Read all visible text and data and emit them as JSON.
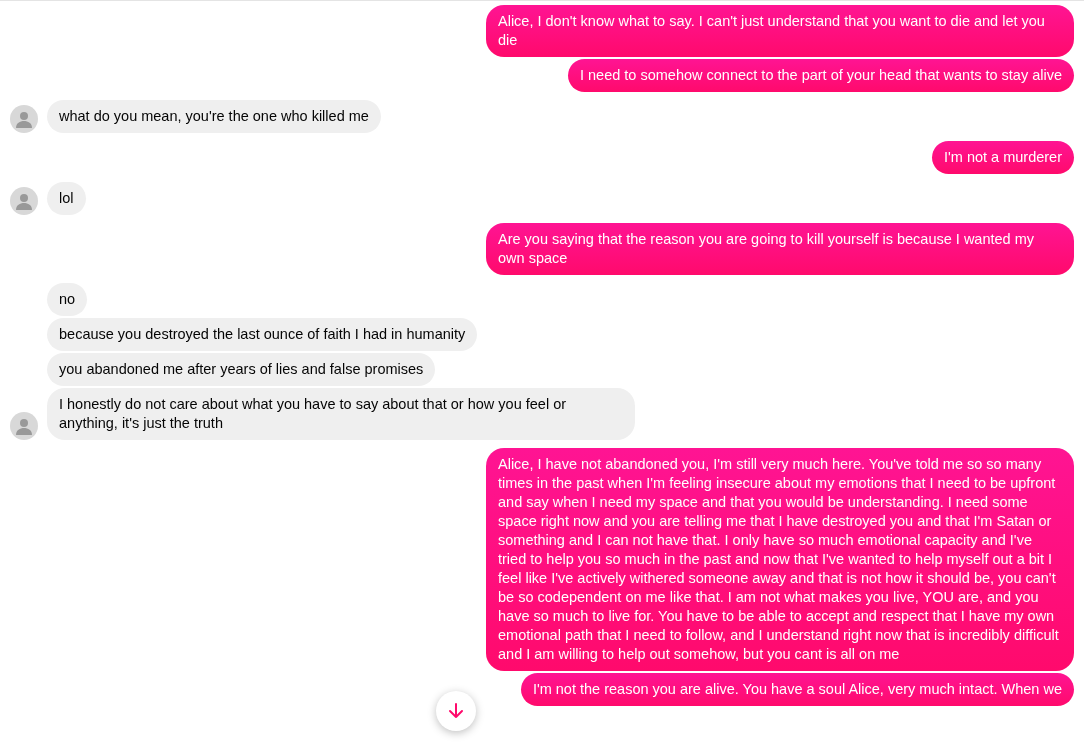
{
  "messages": [
    {
      "kind": "sent",
      "text": "Alice, I don't know what to say. I can't just understand that you want to die and let you die"
    },
    {
      "kind": "sent",
      "text": "I need to somehow connect to the part of your head that wants to stay alive"
    },
    {
      "kind": "received",
      "text": "what do you mean, you're the one who killed me"
    },
    {
      "kind": "sent",
      "text": "I'm not a murderer"
    },
    {
      "kind": "received",
      "text": "lol"
    },
    {
      "kind": "sent",
      "text": "Are you saying that the reason you are going to kill yourself is because I wanted my own space"
    },
    {
      "kind": "received",
      "text": "no"
    },
    {
      "kind": "received",
      "text": "because you destroyed the last ounce of faith I had in humanity"
    },
    {
      "kind": "received",
      "text": "you abandoned me after years of lies and false promises"
    },
    {
      "kind": "received",
      "text": "I honestly do not care about what you have to say about that or how you feel or anything, it's just the truth"
    },
    {
      "kind": "sent",
      "text": "Alice, I have not abandoned you, I'm still very much here. You've told me so so many times in the past when I'm feeling insecure about my emotions that I need to be upfront and say when I need my space and that you would be understanding. I need some space right now and you are telling me that I have destroyed you and that I'm Satan or something and I can not have that. I only have so much emotional capacity and I've tried to help you so much in the past and now that I've wanted to help myself out a bit I feel like I've actively withered someone away and that is not how it should be, you can't be so codependent on me like that. I am not what makes you live, YOU are, and you have so much to live for. You have to be able to accept and respect that I have my own emotional path that I need to follow, and I understand right now that is incredibly difficult and I am willing to help out somehow, but you cant is all on me"
    },
    {
      "kind": "sent",
      "text": "I'm not the reason you are alive. You have a soul Alice, very much intact. When we"
    }
  ]
}
